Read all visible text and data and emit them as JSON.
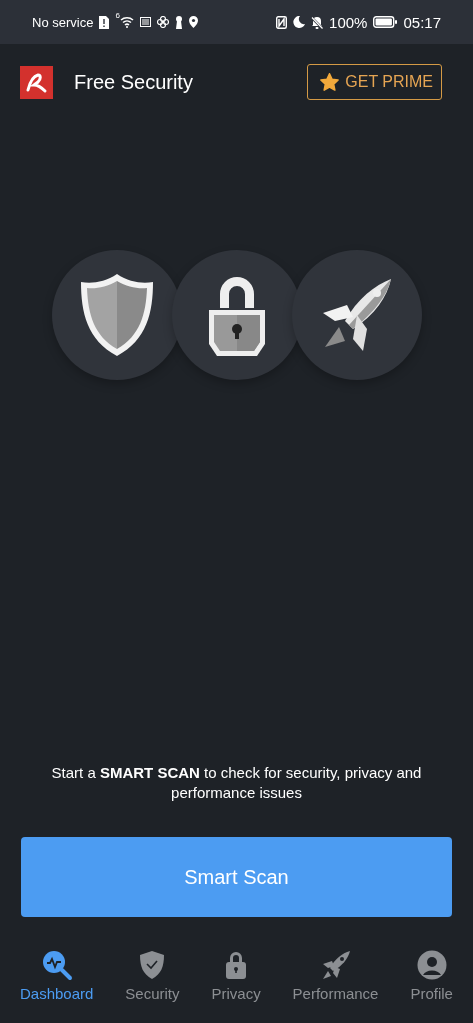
{
  "status_bar": {
    "carrier": "No service",
    "wifi_badge": "6",
    "battery": "100%",
    "time": "05:17"
  },
  "app_bar": {
    "title": "Free Security",
    "prime_button": "GET PRIME"
  },
  "features": [
    {
      "kind": "shield"
    },
    {
      "kind": "lock"
    },
    {
      "kind": "rocket"
    }
  ],
  "prompt": "Start a **SMART SCAN** to check for security, privacy and performance issues",
  "scan_button": "Smart Scan",
  "nav": [
    {
      "kind": "dashboard",
      "label": "Dashboard",
      "selected": true
    },
    {
      "kind": "security",
      "label": "Security",
      "selected": false
    },
    {
      "kind": "privacy",
      "label": "Privacy",
      "selected": false
    },
    {
      "kind": "performance",
      "label": "Performance",
      "selected": false
    },
    {
      "kind": "profile",
      "label": "Profile",
      "selected": false
    }
  ]
}
